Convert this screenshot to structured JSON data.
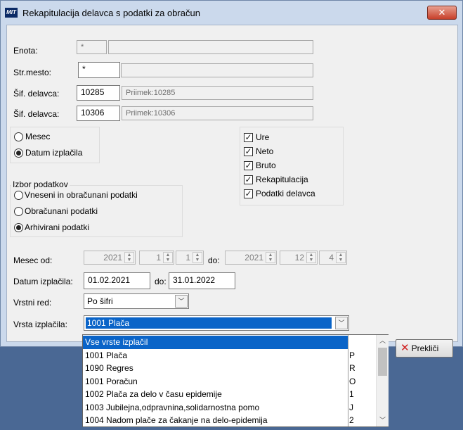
{
  "window": {
    "title": "Rekapitulacija delavca s podatki za obračun",
    "icon_text": "MIT",
    "close_glyph": "✕"
  },
  "form": {
    "enota_label": "Enota:",
    "enota_value": "*",
    "enota_name": "",
    "strmesto_label": "Str.mesto:",
    "strmesto_value": "*",
    "strmesto_name": "",
    "sif1_label": "Šif. delavca:",
    "sif1_value": "10285",
    "sif1_name": "Priimek:10285",
    "sif2_label": "Šif. delavca:",
    "sif2_value": "10306",
    "sif2_name": "Priimek:10306"
  },
  "period_radios": [
    {
      "label": "Mesec",
      "checked": false
    },
    {
      "label": "Datum izplačila",
      "checked": true
    }
  ],
  "checks": [
    {
      "label": "Ure",
      "checked": true
    },
    {
      "label": "Neto",
      "checked": true
    },
    {
      "label": "Bruto",
      "checked": true
    },
    {
      "label": "Rekapitulacija",
      "checked": true
    },
    {
      "label": "Podatki delavca",
      "checked": true
    }
  ],
  "izbor": {
    "title": "Izbor podatkov",
    "options": [
      {
        "label": "Vneseni in obračunani podatki",
        "checked": false
      },
      {
        "label": "Obračunani podatki",
        "checked": false
      },
      {
        "label": "Arhivirani podatki",
        "checked": true
      }
    ]
  },
  "mesec": {
    "label": "Mesec od:",
    "from_year": "2021",
    "from_month": "1",
    "from_part": "1",
    "do_label": "do:",
    "to_year": "2021",
    "to_month": "12",
    "to_part": "4"
  },
  "datum": {
    "label": "Datum izplačila:",
    "from": "01.02.2021",
    "do_label": "do:",
    "to": "31.01.2022"
  },
  "vrstni_red": {
    "label": "Vrstni red:",
    "value": "Po šifri"
  },
  "vrsta": {
    "label": "Vrsta izplačila:",
    "value": "1001  Plača"
  },
  "buttons": {
    "cancel": "Prekliči"
  },
  "dropdown": {
    "items": [
      {
        "name": "Vse vrste izplačil",
        "code": "",
        "selected": true
      },
      {
        "name": "1001  Plača",
        "code": "P",
        "selected": false
      },
      {
        "name": "1090  Regres",
        "code": "R",
        "selected": false
      },
      {
        "name": "1001  Poračun",
        "code": "O",
        "selected": false
      },
      {
        "name": "1002  Plača za delo v času epidemije",
        "code": "1",
        "selected": false
      },
      {
        "name": "1003  Jubilejna,odpravnina,solidarnostna pomo",
        "code": "J",
        "selected": false
      },
      {
        "name": "1004  Nadom plače za čakanje na delo-epidemija",
        "code": "2",
        "selected": false
      }
    ]
  }
}
